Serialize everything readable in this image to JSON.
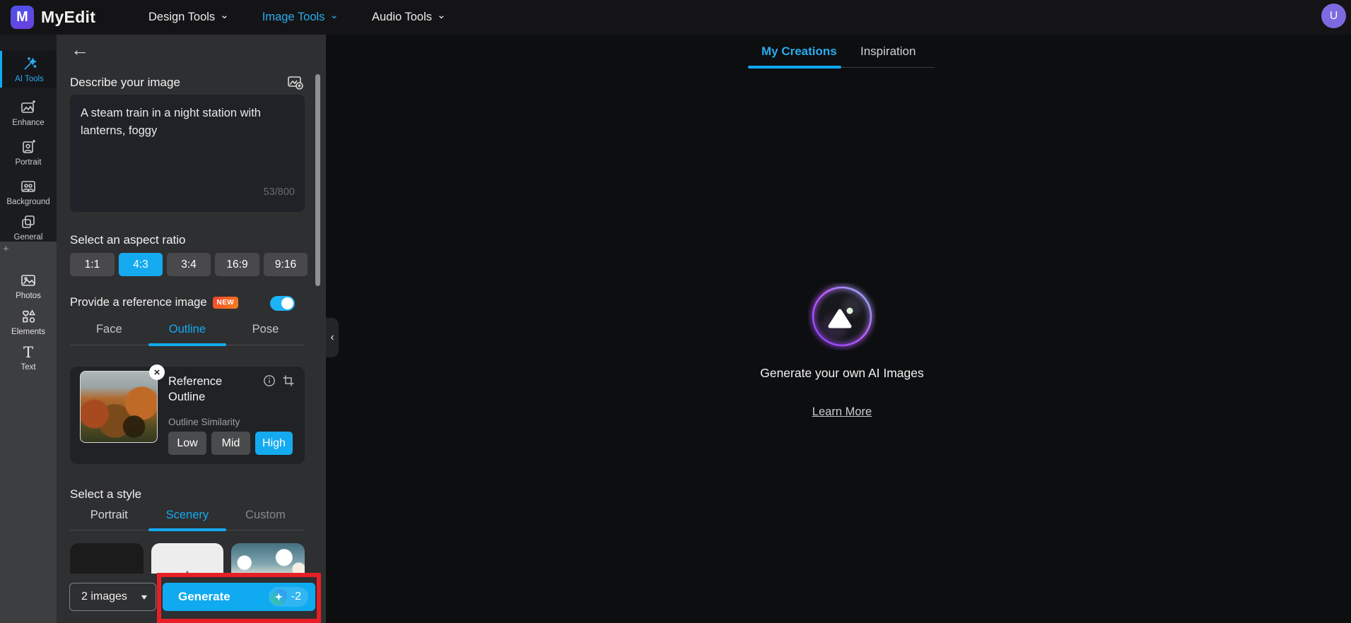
{
  "topbar": {
    "brand": "MyEdit",
    "nav": [
      {
        "label": "Design Tools"
      },
      {
        "label": "Image Tools"
      },
      {
        "label": "Audio Tools"
      }
    ],
    "avatar_initial": "U"
  },
  "sidebar": {
    "top_items": [
      {
        "label": "AI Tools"
      },
      {
        "label": "Enhance"
      },
      {
        "label": "Portrait"
      },
      {
        "label": "Background"
      },
      {
        "label": "General"
      }
    ],
    "bottom_items": [
      {
        "label": "Photos"
      },
      {
        "label": "Elements"
      },
      {
        "label": "Text"
      }
    ],
    "active_item": "AI Tools"
  },
  "panel": {
    "describe_label": "Describe your image",
    "prompt_value": "A steam train in a night station with lanterns, foggy",
    "char_counter": "53/800",
    "aspect_label": "Select an aspect ratio",
    "aspect_options": [
      {
        "label": "1:1"
      },
      {
        "label": "4:3"
      },
      {
        "label": "3:4"
      },
      {
        "label": "16:9"
      },
      {
        "label": "9:16"
      }
    ],
    "aspect_selected": "4:3",
    "reference_label": "Provide a reference image",
    "new_badge": "NEW",
    "reference_toggle_on": true,
    "reference_tabs": [
      {
        "label": "Face"
      },
      {
        "label": "Outline"
      },
      {
        "label": "Pose"
      }
    ],
    "reference_active_tab": "Outline",
    "reference_card": {
      "title": "Reference Outline",
      "similarity_label": "Outline Similarity",
      "levels": [
        {
          "label": "Low"
        },
        {
          "label": "Mid"
        },
        {
          "label": "High"
        }
      ],
      "selected_level": "High"
    },
    "style_label": "Select a style",
    "style_tabs": [
      {
        "label": "Portrait"
      },
      {
        "label": "Scenery"
      },
      {
        "label": "Custom"
      }
    ],
    "style_active_tab": "Scenery",
    "image_count": "2 images",
    "generate_label": "Generate",
    "credit_cost": "-2"
  },
  "main": {
    "tabs": [
      {
        "label": "My Creations"
      },
      {
        "label": "Inspiration"
      }
    ],
    "active_tab": "My Creations",
    "empty_title": "Generate your own AI Images",
    "learn_more": "Learn More"
  },
  "glyphs": {
    "back": "←",
    "nav_chevron": "⌄",
    "collapse": "‹",
    "close": "×",
    "plus": "+",
    "count_caret": "▾"
  },
  "colors": {
    "accent": "#14aaf0",
    "highlight_red": "#e81f27",
    "badge_orange": "#f4542a",
    "avatar_purple": "#7d6ae0"
  }
}
